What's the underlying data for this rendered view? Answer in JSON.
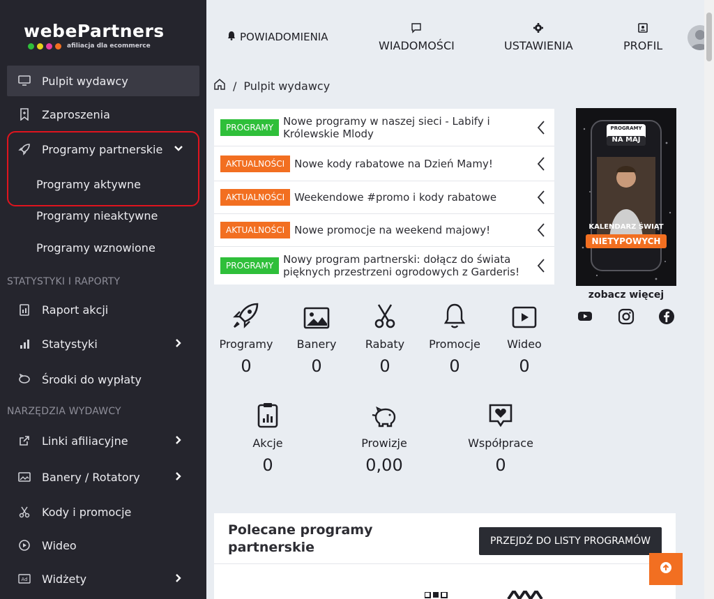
{
  "brand": {
    "name": "webePartners",
    "tagline": "afiliacja dla ecommerce",
    "dot_colors": [
      "#2fbf3a",
      "#e6d21c",
      "#e83fa0",
      "#f26f21"
    ]
  },
  "sidebar": {
    "items": [
      {
        "label": "Pulpit wydawcy"
      },
      {
        "label": "Zaproszenia"
      },
      {
        "label": "Programy partnerskie"
      }
    ],
    "programs_sub": [
      "Programy aktywne",
      "Programy nieaktywne",
      "Programy wznowione"
    ],
    "section_stats": "STATYSTYKI I RAPORTY",
    "stats_items": [
      {
        "label": "Raport akcji"
      },
      {
        "label": "Statystyki"
      },
      {
        "label": "Środki do wypłaty"
      }
    ],
    "section_tools": "NARZĘDZIA WYDAWCY",
    "tools_items": [
      {
        "label": "Linki afiliacyjne"
      },
      {
        "label": "Banery / Rotatory"
      },
      {
        "label": "Kody i promocje"
      },
      {
        "label": "Wideo"
      },
      {
        "label": "Widżety"
      }
    ]
  },
  "topbar": {
    "notifications": "POWIADOMIENIA",
    "messages": "WIADOMOŚCI",
    "settings": "USTAWIENIA",
    "profile": "PROFIL"
  },
  "breadcrumb": {
    "current": "Pulpit wydawcy",
    "separator": "/"
  },
  "news": [
    {
      "tag": "PROGRAMY",
      "tag_color": "#2fbf3a",
      "text": "Nowe programy w naszej sieci - Labify i Królewskie Mlody"
    },
    {
      "tag": "AKTUALNOŚCI",
      "tag_color": "#f26f21",
      "text": "Nowe kody rabatowe na Dzień Mamy!"
    },
    {
      "tag": "AKTUALNOŚCI",
      "tag_color": "#f26f21",
      "text": "Weekendowe #promo i kody rabatowe"
    },
    {
      "tag": "AKTUALNOŚCI",
      "tag_color": "#f26f21",
      "text": "Nowe promocje na weekend majowy!"
    },
    {
      "tag": "PROGRAMY",
      "tag_color": "#2fbf3a",
      "text": "Nowy program partnerski: dołącz do świata pięknych przestrzeni ogrodowych z Garderis!"
    }
  ],
  "promo": {
    "badge_top": "PROGRAMY",
    "badge_bottom": "NA MAJ",
    "caption": "KALENDARZ ŚWIĄT",
    "highlight": "NIETYPOWYCH",
    "see_more": "zobacz więcej"
  },
  "stats": [
    {
      "name": "Programy",
      "value": "0",
      "icon": "rocket-icon"
    },
    {
      "name": "Banery",
      "value": "0",
      "icon": "image-icon"
    },
    {
      "name": "Rabaty",
      "value": "0",
      "icon": "scissors-icon"
    },
    {
      "name": "Promocje",
      "value": "0",
      "icon": "bell-icon"
    },
    {
      "name": "Wideo",
      "value": "0",
      "icon": "play-icon"
    },
    {
      "name": "Akcje",
      "value": "0",
      "icon": "clipboard-chart-icon"
    },
    {
      "name": "Prowizje",
      "value": "0,00",
      "icon": "piggy-bank-icon"
    },
    {
      "name": "Współprace",
      "value": "0",
      "icon": "heart-message-icon"
    }
  ],
  "recommended": {
    "title": "Polecane programy partnerskie",
    "button": "PRZEJDŹ DO LISTY PROGRAMÓW"
  }
}
